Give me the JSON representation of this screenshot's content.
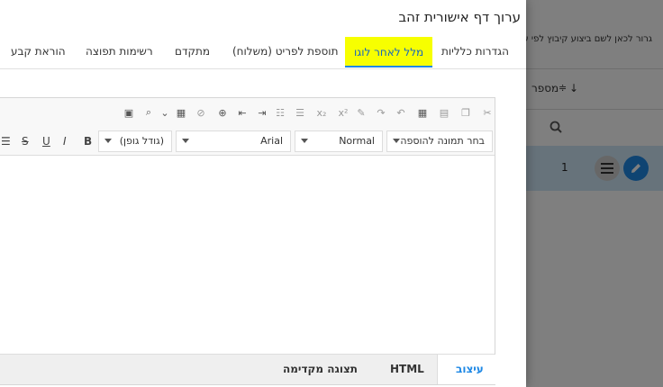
{
  "background": {
    "group_bar_text": "גרור לכאן לשם ביצוע קיבוץ לפי עמודה",
    "column_header": {
      "label": "מספר",
      "sort_icon": "sort-desc-icon",
      "filter_icon": "filter-icon"
    },
    "filter_row": {
      "icon": "search-icon"
    },
    "row": {
      "number": "1"
    },
    "accent": "#1e88e5"
  },
  "modal": {
    "title": "ערוך דף אישורית זהב",
    "tabs": [
      {
        "label": "הגדרות כלליות",
        "active": false
      },
      {
        "label": "מלל לאחר לוגו",
        "active": true
      },
      {
        "label": "תוספת לפריט (משלוח)",
        "active": false
      },
      {
        "label": "מתקדם",
        "active": false
      },
      {
        "label": "רשימות תפוצה",
        "active": false
      },
      {
        "label": "הוראת קבע",
        "active": false
      }
    ],
    "editor": {
      "image_select": "בחר תמונה להוספה",
      "format_select": "Normal",
      "font_select": "Arial",
      "size_select": "(גודל גופן)",
      "format_buttons": [
        "B",
        "I",
        "U",
        "S"
      ],
      "bottom_tabs": [
        "עיצוב",
        "HTML",
        "תצוגה מקדימה"
      ]
    }
  }
}
